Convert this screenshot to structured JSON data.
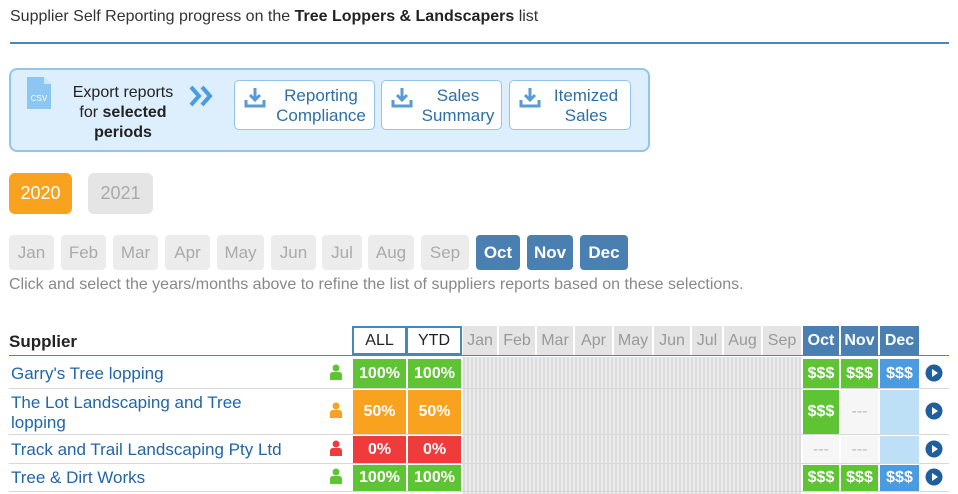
{
  "header": {
    "prefix": "Supplier Self Reporting progress on the ",
    "list_name": "Tree Loppers & Landscapers",
    "suffix": " list"
  },
  "export": {
    "icon": "csv-file-icon",
    "csv_label": "CSV",
    "line1": "Export reports",
    "line2_prefix": "for ",
    "line2_bold": "selected",
    "line3": "periods",
    "buttons": [
      {
        "line1": "Reporting",
        "line2": "Compliance"
      },
      {
        "line1": "Sales",
        "line2": "Summary"
      },
      {
        "line1": "Itemized",
        "line2": "Sales"
      }
    ]
  },
  "years": [
    {
      "label": "2020",
      "selected": true
    },
    {
      "label": "2021",
      "selected": false
    }
  ],
  "months": [
    {
      "label": "Jan",
      "selected": false
    },
    {
      "label": "Feb",
      "selected": false
    },
    {
      "label": "Mar",
      "selected": false
    },
    {
      "label": "Apr",
      "selected": false
    },
    {
      "label": "May",
      "selected": false
    },
    {
      "label": "Jun",
      "selected": false
    },
    {
      "label": "Jul",
      "selected": false
    },
    {
      "label": "Aug",
      "selected": false
    },
    {
      "label": "Sep",
      "selected": false
    },
    {
      "label": "Oct",
      "selected": true
    },
    {
      "label": "Nov",
      "selected": true
    },
    {
      "label": "Dec",
      "selected": true
    }
  ],
  "hint": "Click and select the years/months above to refine the list of suppliers reports based on these selections.",
  "table": {
    "supplier_header": "Supplier",
    "all_header": "ALL",
    "ytd_header": "YTD",
    "month_headers": [
      "Jan",
      "Feb",
      "Mar",
      "Apr",
      "May",
      "Jun",
      "Jul",
      "Aug",
      "Sep",
      "Oct",
      "Nov",
      "Dec"
    ],
    "rows": [
      {
        "name": "Garry's Tree lopping",
        "status": "green",
        "all": "100%",
        "ytd": "100%",
        "oct": "$$$",
        "nov": "$$$",
        "dec": "$$$"
      },
      {
        "name_line1": "The Lot Landscaping and Tree",
        "name_line2": "lopping",
        "status": "orange",
        "all": "50%",
        "ytd": "50%",
        "oct": "$$$",
        "nov": "---",
        "dec": ""
      },
      {
        "name": "Track and Trail Landscaping Pty Ltd",
        "status": "red",
        "all": "0%",
        "ytd": "0%",
        "oct": "---",
        "nov": "---",
        "dec": ""
      },
      {
        "name": "Tree & Dirt Works",
        "status": "green",
        "all": "100%",
        "ytd": "100%",
        "oct": "$$$",
        "nov": "$$$",
        "dec": "$$$"
      }
    ]
  },
  "colors": {
    "accent_blue": "#4a80b1",
    "link_blue": "#2066a8",
    "green": "#5ec434",
    "orange": "#f9a21f",
    "red": "#ee3c3c",
    "light_blue": "#bde0f7"
  }
}
